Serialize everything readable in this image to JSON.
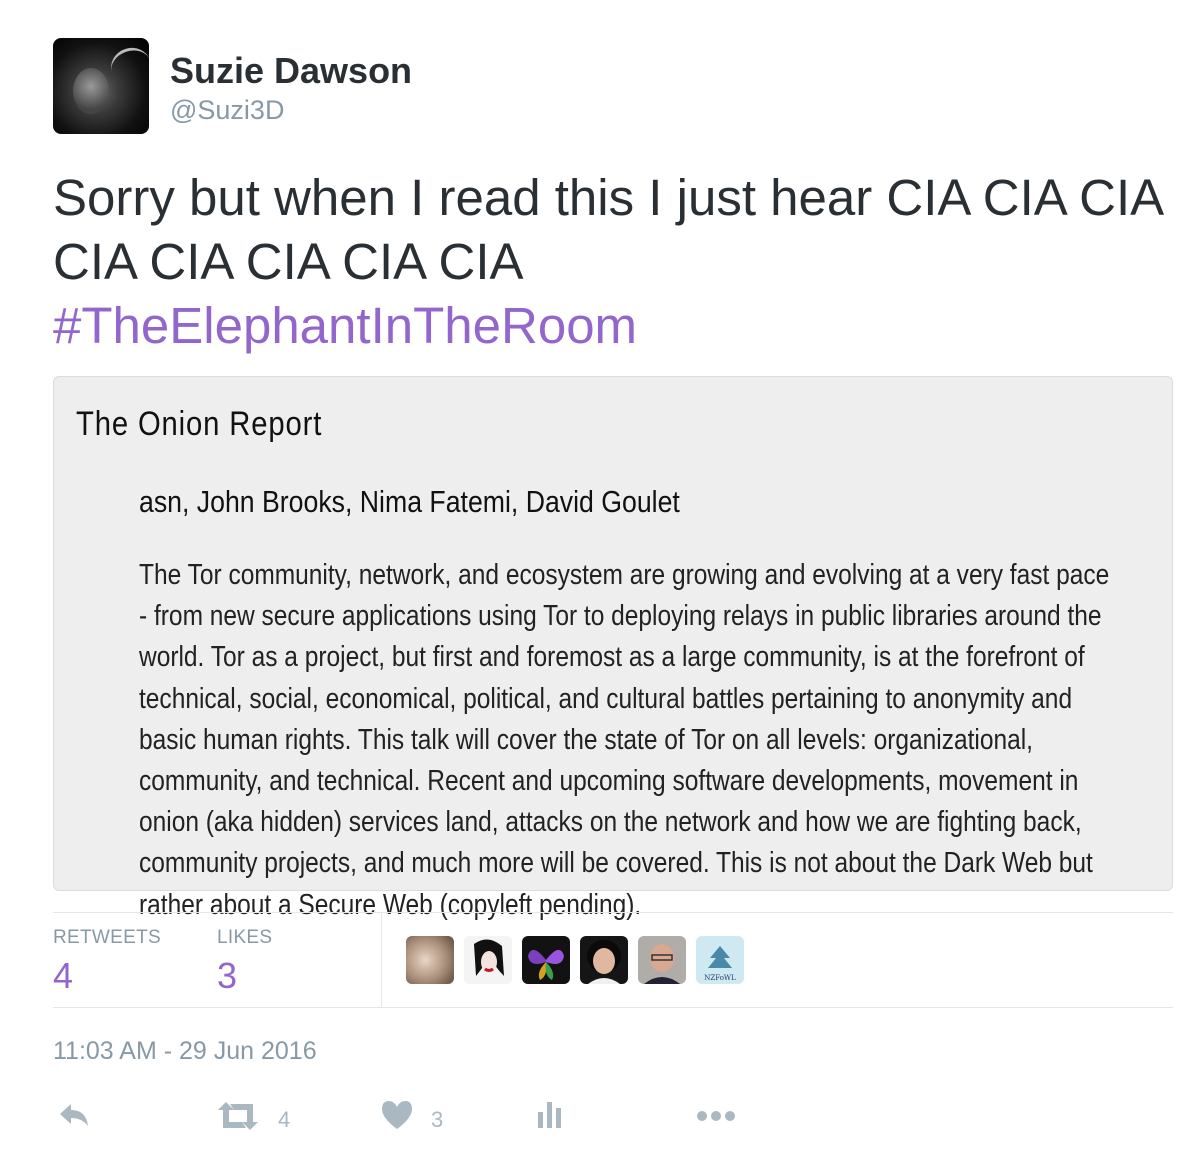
{
  "author": {
    "display_name": "Suzie Dawson",
    "handle": "@Suzi3D",
    "avatar_icon": "profile-photo"
  },
  "tweet": {
    "text": "Sorry but when I read this I just hear CIA CIA CIA CIA CIA CIA CIA CIA",
    "hashtag": "#TheElephantInTheRoom"
  },
  "card": {
    "title": "The Onion Report",
    "authors": "asn, John Brooks, Nima Fatemi, David Goulet",
    "abstract": "The Tor community, network, and ecosystem are growing and evolving at a very fast pace - from new secure applications using Tor to deploying relays in public libraries around the world. Tor as a project, but first and foremost as a large community, is at the forefront of technical, social, economical, political, and cultural battles pertaining to anonymity and basic human rights. This talk will cover the state of Tor on all levels: organizational, community, and technical. Recent and upcoming software developments, movement in onion (aka hidden) services land, attacks on the network and how we are fighting back, community projects, and much more will be covered. This is not about the Dark Web but rather about a Secure Web (copyleft pending)."
  },
  "stats": {
    "retweets_label": "RETWEETS",
    "retweets_count": "4",
    "likes_label": "LIKES",
    "likes_count": "3"
  },
  "likers": [
    {
      "name": "liker-avatar-1"
    },
    {
      "name": "liker-avatar-2"
    },
    {
      "name": "liker-avatar-3"
    },
    {
      "name": "liker-avatar-4"
    },
    {
      "name": "liker-avatar-5"
    },
    {
      "name": "liker-avatar-6",
      "badge": "NZFoWL"
    }
  ],
  "timestamp": "11:03 AM - 29 Jun 2016",
  "actions": {
    "reply_icon": "reply-icon",
    "retweet_icon": "retweet-icon",
    "retweet_count": "4",
    "like_icon": "heart-icon",
    "like_count": "3",
    "analytics_icon": "analytics-icon",
    "more_icon": "more-icon"
  },
  "colors": {
    "hashtag": "#9266cc",
    "count": "#9266cc",
    "muted": "#8899a6",
    "icon": "#aab8c2",
    "card_bg": "#eeeeee"
  }
}
